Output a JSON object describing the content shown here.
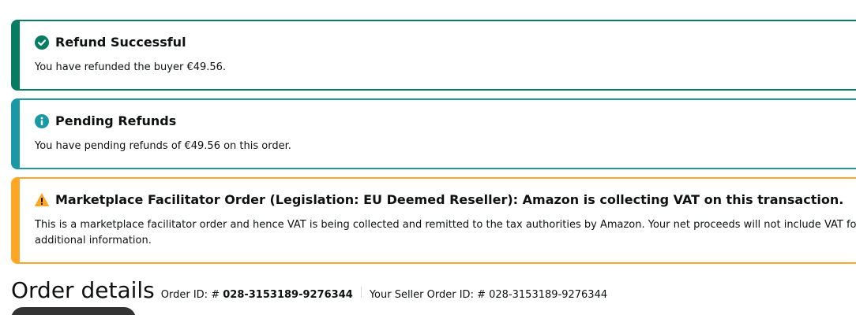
{
  "alerts": {
    "success": {
      "title": "Refund Successful",
      "body": "You have refunded the buyer €49.56.",
      "color": "#067d62",
      "icon": "check-circle-icon"
    },
    "info": {
      "title": "Pending Refunds",
      "body": "You have pending refunds of €49.56 on this order.",
      "color": "#1a98a6",
      "icon": "info-circle-icon"
    },
    "warning": {
      "title": "Marketplace Facilitator Order (Legislation: EU Deemed Reseller): Amazon is collecting VAT on this transaction.",
      "body_line1": "This is a marketplace facilitator order and hence VAT is being collected and remitted to the tax authorities by Amazon. Your net proceeds will not include VAT for Ma",
      "body_line2": "additional information.",
      "color": "#ffa724",
      "icon": "warning-triangle-icon"
    }
  },
  "order": {
    "title": "Order details",
    "order_id_label": "Order ID: #",
    "order_id": "028-3153189-9276344",
    "seller_order_id_label": "Your Seller Order ID: #",
    "seller_order_id": "028-3153189-9276344"
  }
}
